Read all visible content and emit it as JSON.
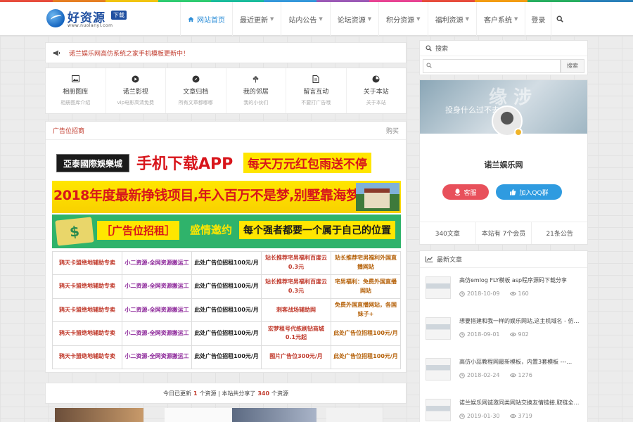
{
  "rainbow": [
    "#e74c3c",
    "#e67e22",
    "#f1c40f",
    "#2ecc71",
    "#1abc9c",
    "#3498db",
    "#9b59b6",
    "#e84393",
    "#e74c3c",
    "#f39c12",
    "#27ae60",
    "#2980b9"
  ],
  "logo": {
    "title": "好资源",
    "badge": "下载",
    "url": "www.nuolanyl.com"
  },
  "nav": {
    "items": [
      {
        "label": "网站首页"
      },
      {
        "label": "最近更新"
      },
      {
        "label": "站内公告"
      },
      {
        "label": "论坛资源"
      },
      {
        "label": "积分资源"
      },
      {
        "label": "福利资源"
      },
      {
        "label": "客户系统"
      }
    ],
    "login": "登录"
  },
  "notice": {
    "text": "诺兰娱乐网高仿系统之家手机模板更新中！"
  },
  "quick_links": [
    {
      "title": "相册图库",
      "sub": "相册图库介绍"
    },
    {
      "title": "诺兰影视",
      "sub": "vip电影高清免费"
    },
    {
      "title": "文章归档",
      "sub": "所有文章都哪哪"
    },
    {
      "title": "我的邻居",
      "sub": "我的小伙们"
    },
    {
      "title": "留言互动",
      "sub": "不要打广告哦"
    },
    {
      "title": "关于本站",
      "sub": "关于本站"
    }
  ],
  "ad": {
    "title": "广告位招商",
    "buy": "购买",
    "banner1": {
      "logo": "亞泰國際娛樂城",
      "app": "手机下载APP",
      "red": "每天万元红包雨送不停"
    },
    "banner2": {
      "text": "2018年度最新挣钱项目,年入百万不是梦,别墅靠海梦成真"
    },
    "banner3": {
      "money": "$",
      "zu": "［广告位招租］",
      "ask": "盛情邀约",
      "slogan": "每个强者都要一个属于自己的位置"
    },
    "links": [
      "鸦天卡盟绝地辅助专卖",
      "小二资源-全网资源搬运工",
      "此处广告位招租100元/月",
      "站长推荐宅男福利百度云0.3元",
      "站长推荐宅男福利外国直播网站",
      "鸦天卡盟绝地辅助专卖",
      "小二资源-全网资源搬运工",
      "此处广告位招租100元/月",
      "站长推荐宅男福利百度云0.3元",
      "宅男福利：免费外国直播网站",
      "鸦天卡盟绝地辅助专卖",
      "小二资源-全网资源搬运工",
      "此处广告位招租100元/月",
      "刺客战场辅助网",
      "免费外国直播网站，各国妹子+",
      "鸦天卡盟绝地辅助专卖",
      "小二资源-全网资源搬运工",
      "此处广告位招租100元/月",
      "宏梦租号代练刷钻商城0.1元起",
      "此处广告位招租100元/月",
      "鸦天卡盟绝地辅助专卖",
      "小二资源-全网资源搬运工",
      "此处广告位招租100元/月",
      "图片广告位300元/月",
      "此处广告位招租100元/月"
    ],
    "link_colors": [
      "#c0392b",
      "#8e2a9b",
      "#1b1b1b",
      "#c0392b",
      "#b45f06"
    ]
  },
  "stats": {
    "prefix": "今日已更新",
    "today": "1",
    "mid": "个资源 | 本站共分享了",
    "total": "340",
    "suffix": "个资源"
  },
  "sidebar": {
    "search": {
      "title": "搜索",
      "placeholder": "",
      "button": "搜索"
    },
    "profile": {
      "cover_text": "投身什么过不去 …",
      "cover_big": "缘 涉",
      "name": "诺兰娱乐网",
      "btn_kf": "客服",
      "btn_qq": "加入QQ群",
      "stats": [
        "340文章",
        "本站有 7个会员",
        "21条公告"
      ]
    },
    "latest": {
      "title": "最新文章",
      "items": [
        {
          "title": "高仿emlog FLY模板 asp程序源码下载分享",
          "date": "2018-10-09",
          "views": "160"
        },
        {
          "title": "想要搭建和我一样的娱乐网站,这主机域名 - 仿…",
          "date": "2018-09-01",
          "views": "902"
        },
        {
          "title": "高仿小蕊教程网最新模板，内置3套模板 ---…",
          "date": "2018-02-24",
          "views": "1276"
        },
        {
          "title": "诺兰娱乐网诚邀同类网站交换友情链接,取链全…",
          "date": "2019-01-30",
          "views": "3719"
        }
      ]
    }
  }
}
